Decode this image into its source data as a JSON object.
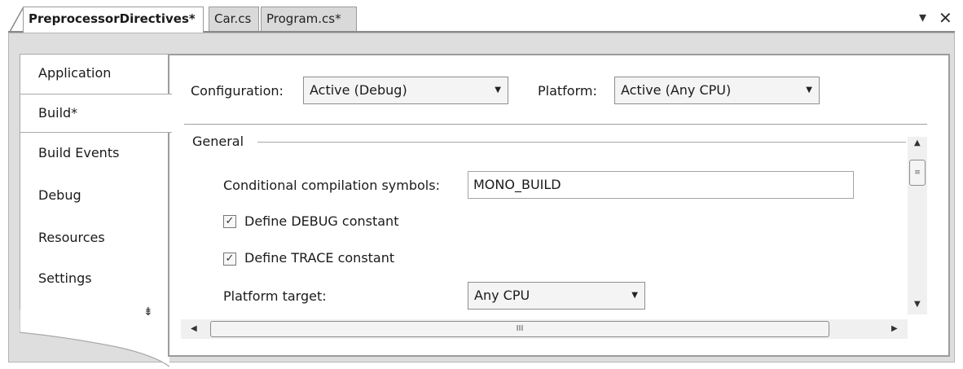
{
  "doc_tabs": [
    {
      "label": "PreprocessorDirectives*",
      "active": true
    },
    {
      "label": "Car.cs",
      "active": false
    },
    {
      "label": "Program.cs*",
      "active": false
    }
  ],
  "window": {
    "dropdown_glyph": "▾",
    "close_glyph": "✕"
  },
  "side_tabs": [
    "Application",
    "Build*",
    "Build Events",
    "Debug",
    "Resources",
    "Settings"
  ],
  "selected_side_tab": "Build*",
  "side_scroll_glyph": "⇟",
  "build": {
    "configuration_label": "Configuration:",
    "configuration_value": "Active (Debug)",
    "platform_label": "Platform:",
    "platform_value": "Active (Any CPU)",
    "group_general": "General",
    "symbols_label": "Conditional compilation symbols:",
    "symbols_value": "MONO_BUILD",
    "define_debug_label": "Define DEBUG constant",
    "define_debug_checked": true,
    "define_trace_label": "Define TRACE constant",
    "define_trace_checked": true,
    "platform_target_label": "Platform target:",
    "platform_target_value": "Any CPU",
    "check_glyph": "✓",
    "combo_arrow_glyph": "▼"
  },
  "scrollbar": {
    "up_glyph": "▲",
    "down_glyph": "▼",
    "left_glyph": "◀",
    "right_glyph": "▶",
    "vthumb_grip": "≡",
    "hthumb_grip": "III"
  }
}
